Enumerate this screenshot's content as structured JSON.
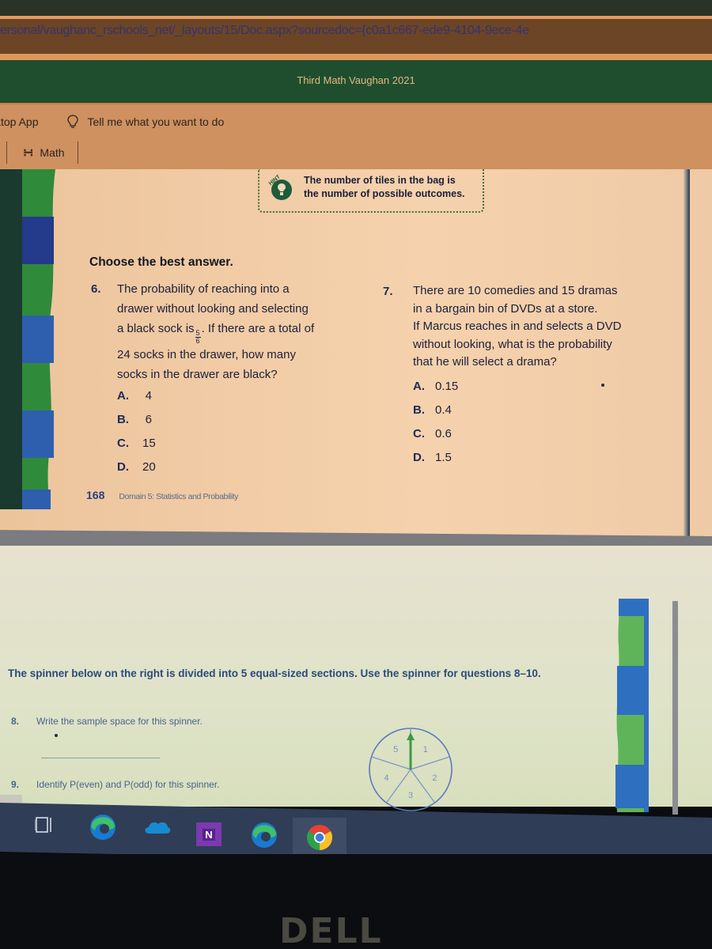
{
  "browser": {
    "address_url": "ersonal/vaughanc_rschools_net/_layouts/15/Doc.aspx?sourcedoc={c0a1c667-ede9-4104-9ece-4e"
  },
  "app": {
    "title": "Third Math Vaughan 2021",
    "ribbon": {
      "app_label": "ktop App",
      "tell_me": "Tell me what you want to do",
      "math_button": "Math"
    }
  },
  "document": {
    "hint": {
      "badge": "HINT",
      "text_line1": "The number of tiles in the bag is",
      "text_line2": "the number of possible outcomes."
    },
    "instructions": "Choose the best answer.",
    "questions": [
      {
        "number": "6.",
        "lines": [
          "The probability of reaching into a",
          "drawer without looking and selecting",
          "a black sock is",
          ". If there are a total of",
          "24 socks in the drawer, how many",
          "socks in the drawer are black?"
        ],
        "fraction": {
          "numerator": "5",
          "denominator": "6"
        },
        "options": [
          {
            "letter": "A.",
            "value": "4"
          },
          {
            "letter": "B.",
            "value": "6"
          },
          {
            "letter": "C.",
            "value": "15"
          },
          {
            "letter": "D.",
            "value": "20"
          }
        ]
      },
      {
        "number": "7.",
        "lines": [
          "There are 10 comedies and 15 dramas",
          "in a bargain bin of DVDs at a store.",
          "If Marcus reaches in and selects a DVD",
          "without looking, what is the probability",
          "that he will select a drama?"
        ],
        "options": [
          {
            "letter": "A.",
            "value": "0.15"
          },
          {
            "letter": "B.",
            "value": "0.4"
          },
          {
            "letter": "C.",
            "value": "0.6"
          },
          {
            "letter": "D.",
            "value": "1.5"
          }
        ]
      }
    ],
    "footer": {
      "page_number": "168",
      "domain": "Domain 5: Statistics and Probability"
    },
    "page2": {
      "intro": "The spinner below on the right is divided into 5 equal-sized sections. Use the spinner for questions 8–10.",
      "q8": {
        "number": "8.",
        "text": "Write the sample space for this spinner."
      },
      "q9": {
        "number": "9.",
        "text": "Identify P(even) and P(odd) for this spinner."
      },
      "spinner_sections": [
        "1",
        "2",
        "3",
        "4",
        "5"
      ]
    }
  },
  "taskbar": {
    "icons": [
      "task-view-icon",
      "edge-icon",
      "onedrive-icon",
      "onenote-icon",
      "edge-icon",
      "chrome-icon"
    ],
    "onenote_letter": "N"
  },
  "monitor": {
    "brand": "DELL"
  },
  "colors": {
    "title_bar": "#1f4e2e",
    "ribbon": "#cf915f",
    "page": "#f2c8a0",
    "accent_blue": "#2e3f7e",
    "wave_green": "#2f8a3a",
    "wave_blue": "#2d5fae"
  }
}
